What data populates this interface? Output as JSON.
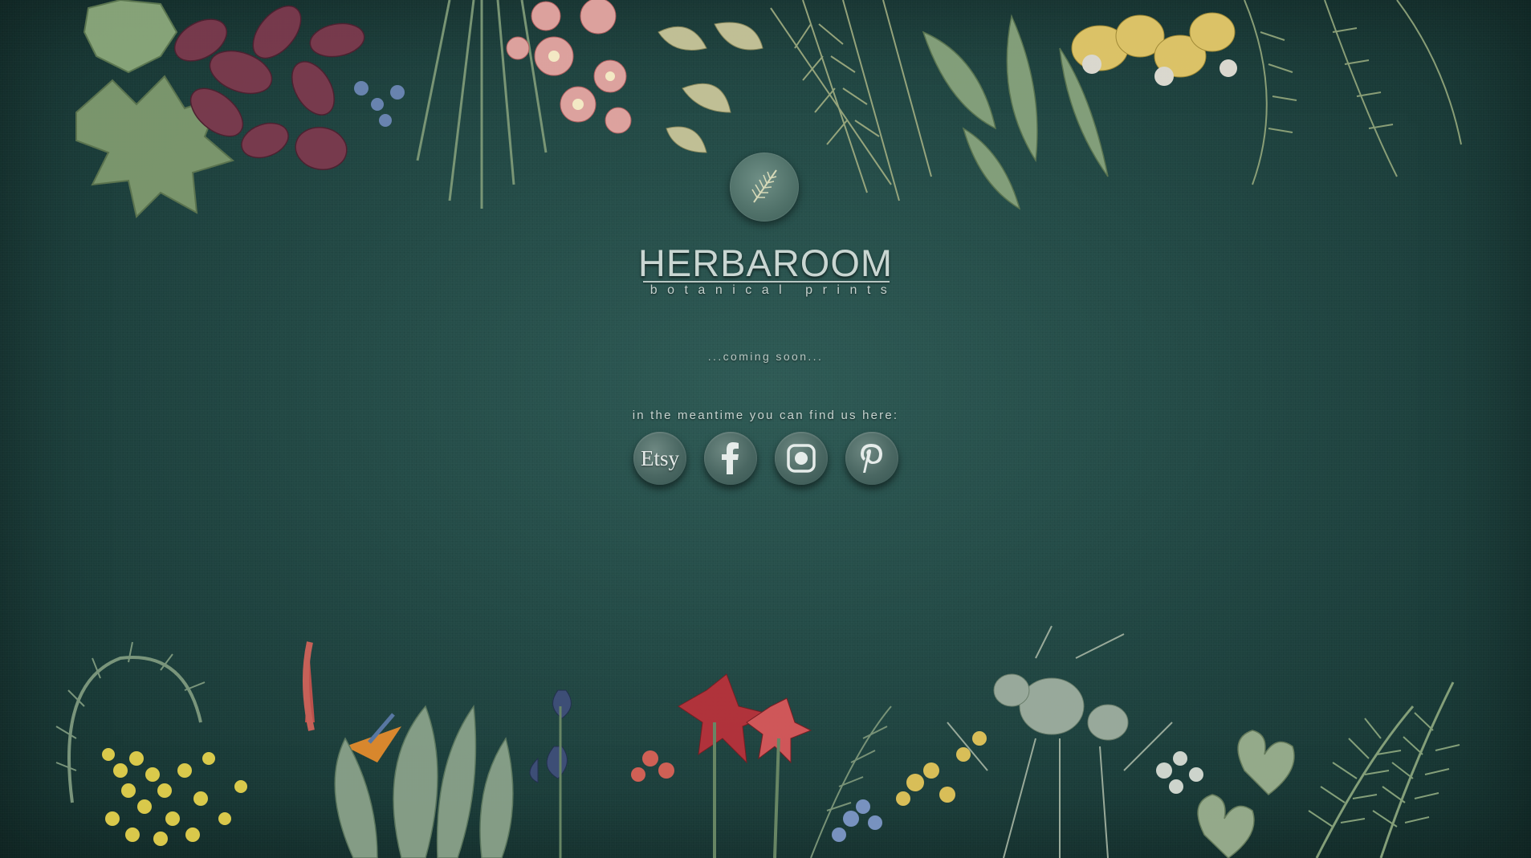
{
  "brand": {
    "name": "HERBAROOM",
    "tagline": "botanical prints",
    "logo_icon": "fern-leaf-icon"
  },
  "status": {
    "coming_soon": "...coming soon..."
  },
  "social": {
    "heading": "in the meantime you can find us here:",
    "links": [
      {
        "label": "Etsy",
        "icon": "etsy-icon"
      },
      {
        "label": "Facebook",
        "icon": "facebook-icon"
      },
      {
        "label": "Instagram",
        "icon": "instagram-icon"
      },
      {
        "label": "Pinterest",
        "icon": "pinterest-icon"
      }
    ]
  },
  "colors": {
    "background": "#234a46",
    "text": "#c9d6d2",
    "button": "#4a6762"
  }
}
